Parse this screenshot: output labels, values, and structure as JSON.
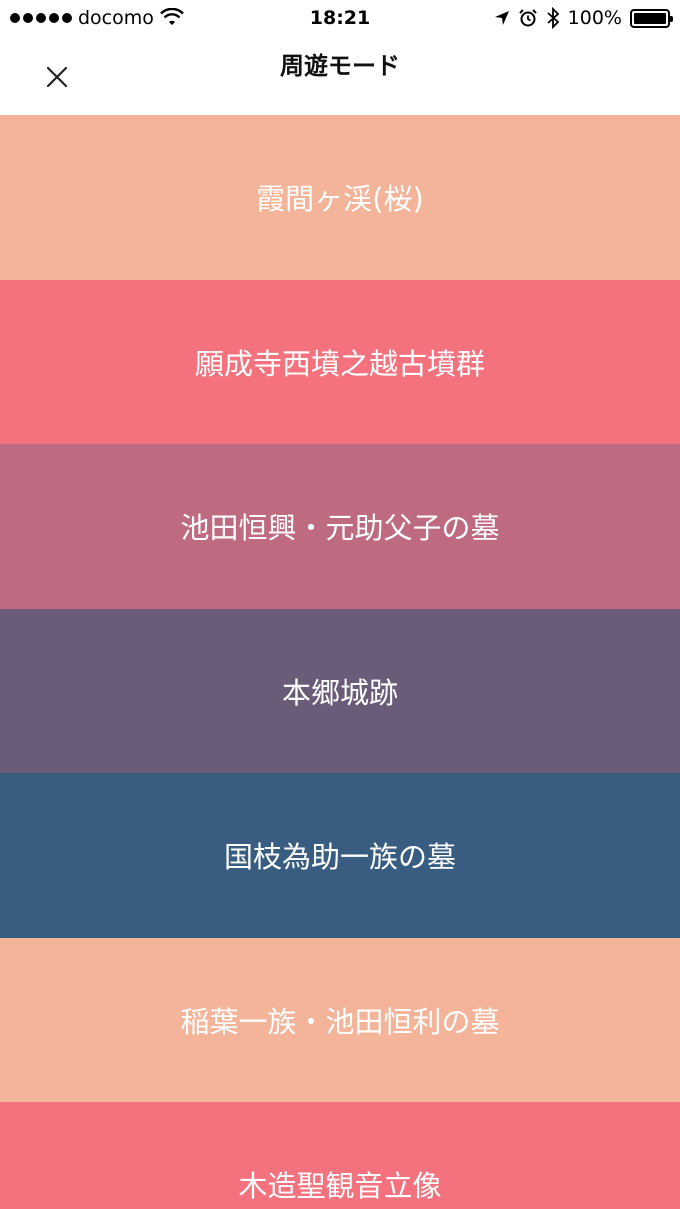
{
  "status_bar": {
    "carrier": "docomo",
    "time": "18:21",
    "battery": "100%",
    "icons": [
      "signal-dots-icon",
      "wifi-icon",
      "location-arrow-icon",
      "alarm-icon",
      "bluetooth-icon",
      "battery-icon"
    ]
  },
  "nav": {
    "title": "周遊モード",
    "close_icon": "close-icon"
  },
  "spots": [
    {
      "label": "霞間ヶ渓(桜)",
      "color": "#F4B49A"
    },
    {
      "label": "願成寺西墳之越古墳群",
      "color": "#F4727D"
    },
    {
      "label": "池田恒興・元助父子の墓",
      "color": "#BE6A80"
    },
    {
      "label": "本郷城跡",
      "color": "#6A5B78"
    },
    {
      "label": "国枝為助一族の墓",
      "color": "#385D80"
    },
    {
      "label": "稲葉一族・池田恒利の墓",
      "color": "#F4B49A"
    },
    {
      "label": "木造聖観音立像",
      "color": "#F4727D"
    }
  ]
}
